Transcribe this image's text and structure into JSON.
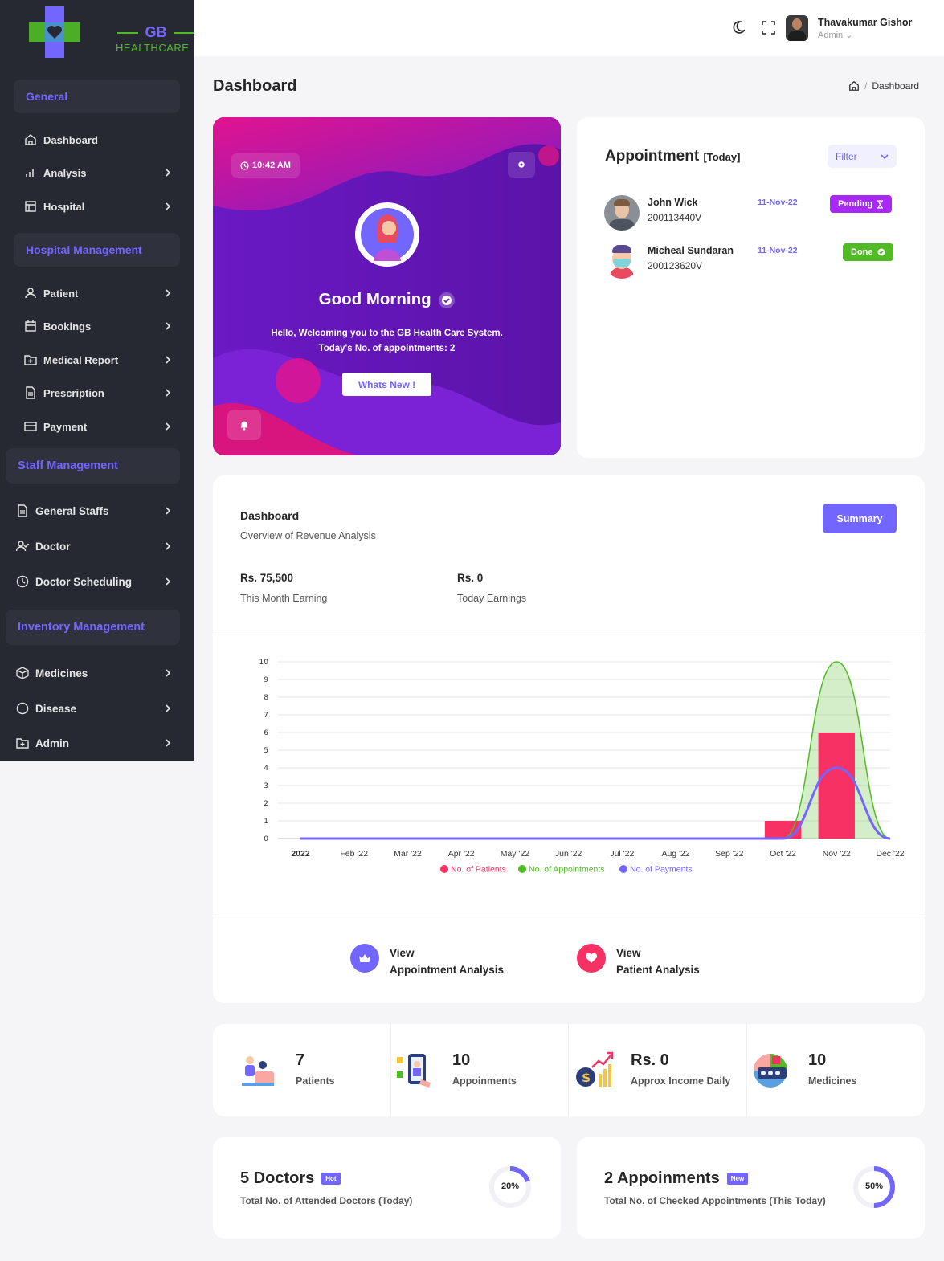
{
  "brand": {
    "line1": "GB",
    "line2": "HEALTHCARE"
  },
  "sidebar": {
    "sections": [
      "General",
      "Hospital Management",
      "Staff Management",
      "Inventory Management"
    ],
    "items": [
      "Dashboard",
      "Analysis",
      "Hospital",
      "Patient",
      "Bookings",
      "Medical Report",
      "Prescription",
      "Payment",
      "General Staffs",
      "Doctor",
      "Doctor Scheduling",
      "Medicines",
      "Disease",
      "Admin"
    ]
  },
  "header": {
    "user_name": "Thavakumar Gishor",
    "user_role": "Admin"
  },
  "page": {
    "title": "Dashboard",
    "breadcrumb": "Dashboard"
  },
  "welcome": {
    "time": "10:42 AM",
    "greeting": "Good Morning",
    "line1": "Hello, Welcoming you to the GB Health Care System.",
    "line2": "Today's No. of appointments: 2",
    "button": "Whats New !"
  },
  "appointment": {
    "title": "Appointment",
    "subtitle": "[Today]",
    "filter": "Filter",
    "rows": [
      {
        "name": "John Wick",
        "id": "200113440V",
        "date": "11-Nov-22",
        "status": "Pending"
      },
      {
        "name": "Micheal Sundaran",
        "id": "200123620V",
        "date": "11-Nov-22",
        "status": "Done"
      }
    ]
  },
  "revenue": {
    "title": "Dashboard",
    "subtitle": "Overview of Revenue Analysis",
    "button": "Summary",
    "month_value": "Rs. 75,500",
    "month_label": "This Month Earning",
    "today_value": "Rs. 0",
    "today_label": "Today Earnings"
  },
  "links": {
    "view1": "View",
    "appt": "Appointment Analysis",
    "view2": "View",
    "patient": "Patient Analysis"
  },
  "stats": [
    {
      "value": "7",
      "label": "Patients"
    },
    {
      "value": "10",
      "label": "Appoinments"
    },
    {
      "value": "Rs. 0",
      "label": "Approx Income Daily"
    },
    {
      "value": "10",
      "label": "Medicines"
    }
  ],
  "bottom": [
    {
      "title": "5 Doctors",
      "tag": "Hot",
      "desc": "Total No. of Attended Doctors (Today)",
      "percent": "20%",
      "fraction": 0.2
    },
    {
      "title": "2 Appoinments",
      "tag": "New",
      "desc": "Total No. of Checked Appointments (This Today)",
      "percent": "50%",
      "fraction": 0.5
    }
  ],
  "colors": {
    "accent": "#7366ff",
    "pending": "#a927f9",
    "done": "#51bb25",
    "sidebar": "#262932",
    "patients": "#f73164",
    "appointments": "#51bb25",
    "payments": "#7366ff"
  },
  "chart_data": {
    "type": "bar",
    "categories": [
      "2022",
      "Feb '22",
      "Mar '22",
      "Apr '22",
      "May '22",
      "Jun '22",
      "Jul '22",
      "Aug '22",
      "Sep '22",
      "Oct '22",
      "Nov '22",
      "Dec '22"
    ],
    "ylim": [
      0,
      10
    ],
    "yticks": [
      "0",
      "1",
      "2",
      "3",
      "4",
      "5",
      "6",
      "7",
      "8",
      "9",
      "10"
    ],
    "series": [
      {
        "name": "No. of Patients",
        "type": "bar",
        "values": [
          0,
          0,
          0,
          0,
          0,
          0,
          0,
          0,
          0,
          1,
          6,
          0
        ]
      },
      {
        "name": "No. of Appointments",
        "type": "area",
        "values": [
          0,
          0,
          0,
          0,
          0,
          0,
          0,
          0,
          0,
          0,
          10,
          0
        ]
      },
      {
        "name": "No. of Payments",
        "type": "line",
        "values": [
          0,
          0,
          0,
          0,
          0,
          0,
          0,
          0,
          0,
          0,
          4,
          0
        ]
      }
    ],
    "legend": "bottom",
    "grid": true
  }
}
